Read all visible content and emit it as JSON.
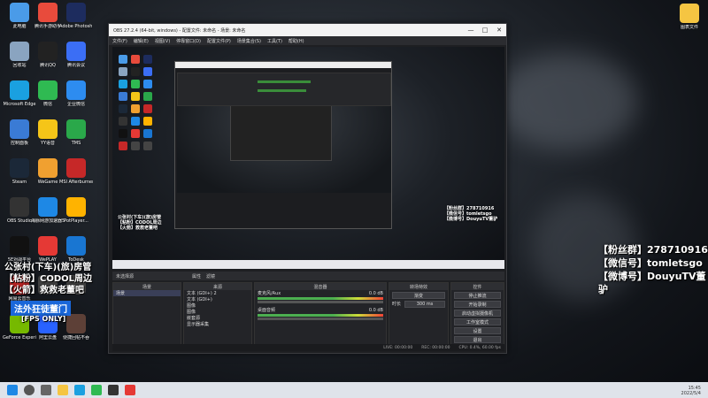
{
  "desktop": {
    "icons": [
      {
        "label": "此电脑",
        "color": "#4a9be8"
      },
      {
        "label": "腾讯手游助手",
        "color": "#e84b3c"
      },
      {
        "label": "Adobe Photosh...",
        "color": "#1d2c5e"
      },
      {
        "label": "回收站",
        "color": "#8aa4c0"
      },
      {
        "label": "腾讯QQ",
        "color": "#222"
      },
      {
        "label": "腾讯会议",
        "color": "#3b6ef5"
      },
      {
        "label": "Microsoft Edge",
        "color": "#1aa0e0"
      },
      {
        "label": "微信",
        "color": "#2fba52"
      },
      {
        "label": "企业微信",
        "color": "#2d8cf0"
      },
      {
        "label": "控制面板",
        "color": "#3a7bd5"
      },
      {
        "label": "YY语音",
        "color": "#f5c518"
      },
      {
        "label": "TMS",
        "color": "#2aa84a"
      },
      {
        "label": "Steam",
        "color": "#1b2838"
      },
      {
        "label": "WeGame",
        "color": "#f0a030"
      },
      {
        "label": "MSI Afterburner",
        "color": "#c62828"
      },
      {
        "label": "OBS Studio",
        "color": "#333"
      },
      {
        "label": "海豚网游加速器5.0",
        "color": "#1e88e5"
      },
      {
        "label": "PotPlayer...",
        "color": "#ffb300"
      },
      {
        "label": "5E对战平台",
        "color": "#111"
      },
      {
        "label": "WePLAY",
        "color": "#e53935"
      },
      {
        "label": "ToDesk",
        "color": "#1976d2"
      },
      {
        "label": "网易云音乐",
        "color": "#c62828"
      },
      {
        "label": "",
        "color": "#444"
      },
      {
        "label": "",
        "color": "#444"
      },
      {
        "label": "GeForce Experience",
        "color": "#76b900"
      },
      {
        "label": "阿里云盘",
        "color": "#2962ff"
      },
      {
        "label": "便捷回帖不吞",
        "color": "#5d4037"
      }
    ],
    "right_icon": {
      "label": "图表文件",
      "color": "#f5c542"
    }
  },
  "obs": {
    "title": "OBS 27.2.4 (64-bit, windows) - 配置文件: 未命名 - 场景: 未命名",
    "menu": [
      "文件(F)",
      "编辑(E)",
      "视图(V)",
      "停靠窗口(D)",
      "配置文件(P)",
      "场景集合(S)",
      "工具(T)",
      "帮助(H)"
    ],
    "toolbar": [
      "未选择源",
      "属性",
      "滤镜"
    ],
    "docks": {
      "scenes": {
        "title": "场景",
        "items": [
          "场景"
        ]
      },
      "sources": {
        "title": "来源",
        "items": [
          "文本 (GDI+) 2",
          "文本 (GDI+)",
          "图像",
          "图像",
          "嵌套源",
          "显示器采集"
        ]
      },
      "mixer": {
        "title": "混音器",
        "channels": [
          {
            "name": "麦克风/Aux",
            "db": "0.0 dB"
          },
          {
            "name": "桌面音频",
            "db": "0.0 dB"
          }
        ]
      },
      "transitions": {
        "title": "转场特效",
        "type": "渐变",
        "duration_label": "时长",
        "duration": "300 ms"
      },
      "controls": {
        "title": "控件",
        "buttons": [
          "停止推流",
          "开始录制",
          "启动虚拟摄像机",
          "工作室模式",
          "设置",
          "退出"
        ]
      }
    },
    "status": {
      "live": "LIVE: 00:00:00",
      "rec": "REC: 00:00:00",
      "cpu": "CPU: 0.4%, 60.00 fps"
    }
  },
  "overlay": {
    "left_lines": [
      "【粉丝群】278710916",
      "【微信号】tomletsgo",
      "【微博号】DouyuTV董驴"
    ],
    "preview_lines": [
      "【粉丝群】278710916",
      "【微信号】tomletsgo",
      "【微博号】DouyuTV董驴"
    ],
    "cn_lines": [
      "公张村(下车)(旅)房管",
      "【粘粉】CODOL周边",
      "【火箭】救救老董吧"
    ],
    "banner": "法外狂徒董门",
    "fps_text": "[FPS ONLY]"
  },
  "taskbar": {
    "time": "15:45",
    "date": "2022/5/4"
  }
}
